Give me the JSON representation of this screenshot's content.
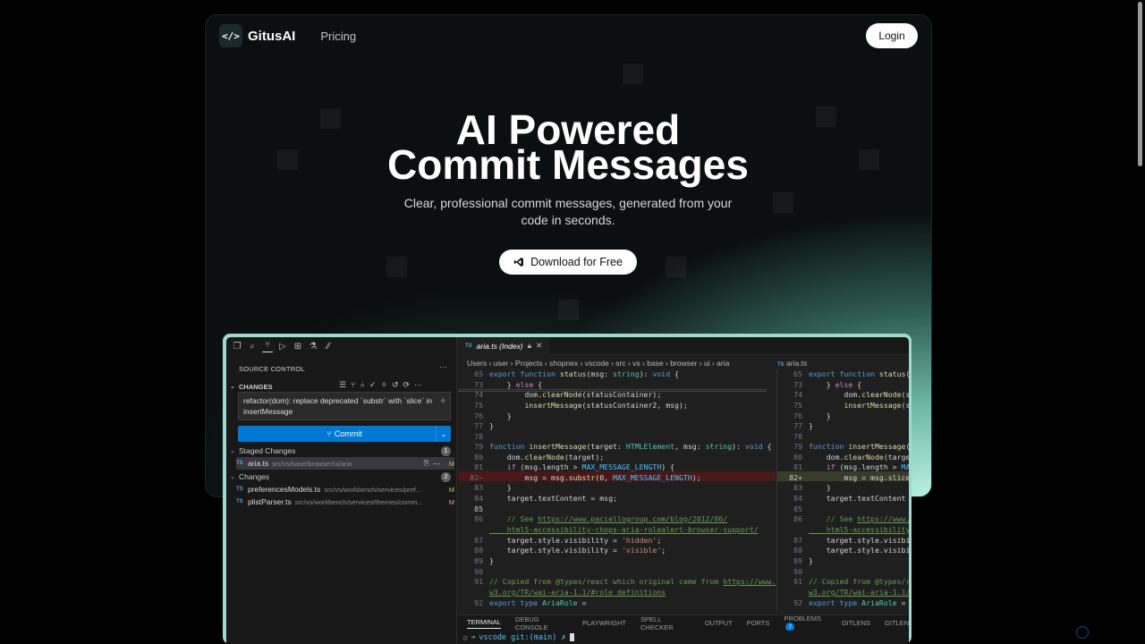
{
  "nav": {
    "brand": "GitusAI",
    "logo_glyph": "</>",
    "pricing": "Pricing",
    "login": "Login"
  },
  "hero": {
    "title_line1": "AI Powered",
    "title_line2": "Commit Messages",
    "subtitle_line1": "Clear, professional commit messages, generated from your",
    "subtitle_line2": "code in seconds.",
    "cta": "Download for Free"
  },
  "ide": {
    "sidebar": {
      "title": "SOURCE CONTROL",
      "changes_header": "CHANGES",
      "commit_message": "refactor(dom): replace deprecated `substr` with `slice` in insertMessage",
      "commit_label": "Commit",
      "staged_header": "Staged Changes",
      "staged_count": "1",
      "staged_files": [
        {
          "name": "aria.ts",
          "path": "src/vs/base/browser/ui/aria",
          "status": "M"
        }
      ],
      "changes_group": "Changes",
      "changes_count": "2",
      "changed_files": [
        {
          "name": "preferencesModels.ts",
          "path": "src/vs/workbench/services/pref...",
          "status": "M"
        },
        {
          "name": "plistParser.ts",
          "path": "src/vs/workbench/services/themes/comm...",
          "status": "M"
        }
      ]
    },
    "editor": {
      "tab_title": "aria.ts (Index)",
      "breadcrumb": "Users › user › Projects › shopnex › vscode › src › vs › base › browser › ui › aria",
      "breadcrumb_right": "aria.ts"
    },
    "panel": {
      "tabs": [
        "TERMINAL",
        "DEBUG CONSOLE",
        "PLAYWRIGHT",
        "SPELL CHECKER",
        "OUTPUT",
        "PORTS",
        "PROBLEMS",
        "GITLENS",
        "GITLEN"
      ],
      "problems_count": "7",
      "terminal_prompt": "vscode git:(main) ✗"
    }
  }
}
